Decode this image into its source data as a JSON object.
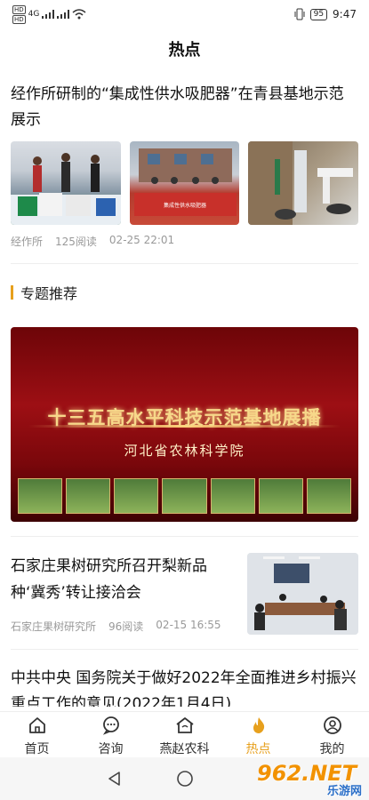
{
  "status": {
    "left_icons": [
      "HD",
      "4G",
      "HD",
      "4G"
    ],
    "battery": "95",
    "time": "9:47"
  },
  "page": {
    "title": "热点"
  },
  "news": [
    {
      "title": "经作所研制的“集成性供水吸肥器”在青县基地示范展示",
      "source": "经作所",
      "reads": "125阅读",
      "date": "02-25 22:01"
    },
    {
      "title": "石家庄果树研究所召开梨新品种‘冀秀’转让接洽会",
      "source": "石家庄果树研究所",
      "reads": "96阅读",
      "date": "02-15 16:55"
    },
    {
      "title": "中共中央 国务院关于做好2022年全面推进乡村振兴重点工作的意见(2022年1月4日)"
    }
  ],
  "section": {
    "label": "专题推荐"
  },
  "banner": {
    "title": "十三五高水平科技示范基地展播",
    "subtitle": "河北省农林科学院"
  },
  "tabs": [
    {
      "label": "首页",
      "icon": "home-icon"
    },
    {
      "label": "咨询",
      "icon": "chat-icon"
    },
    {
      "label": "燕赵农科",
      "icon": "barn-icon"
    },
    {
      "label": "热点",
      "icon": "flame-icon",
      "active": true
    },
    {
      "label": "我的",
      "icon": "user-icon"
    }
  ],
  "watermark": {
    "main": "962.NET",
    "sub": "乐游网"
  },
  "colors": {
    "accent": "#e7a01d",
    "banner_red": "#9d0f14"
  }
}
